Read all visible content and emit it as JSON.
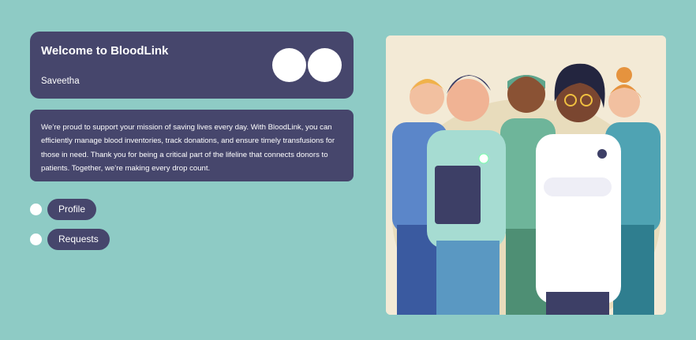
{
  "welcome": {
    "title": "Welcome to BloodLink",
    "user": "Saveetha"
  },
  "message": {
    "text": "We’re proud to support your mission of saving lives every day. With BloodLink, you can efficiently manage blood inventories, track donations, and ensure timely transfusions for those in need. Thank you for being a critical part of the lifeline that connects donors to patients. Together, we’re making every drop count."
  },
  "nav": {
    "profile_label": "Profile",
    "requests_label": "Requests"
  },
  "colors": {
    "background": "#8ecbc5",
    "card": "#46466c",
    "accent": "#ffffff"
  }
}
